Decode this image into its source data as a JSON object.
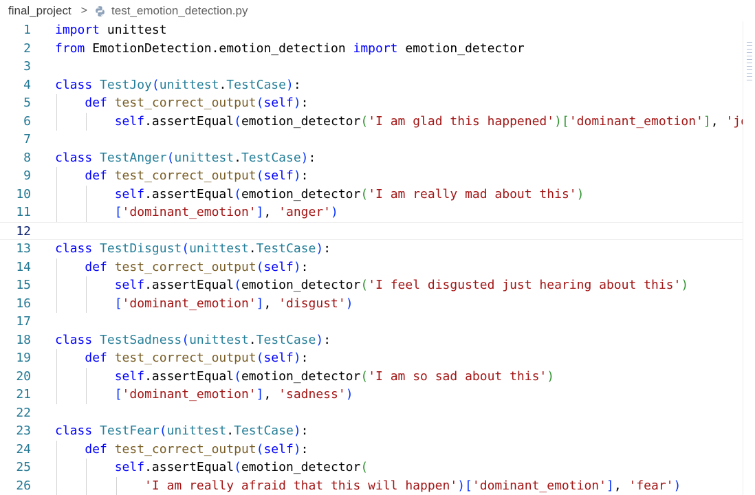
{
  "breadcrumb": {
    "folder": "final_project",
    "separator": ">",
    "file": "test_emotion_detection.py",
    "file_icon": "python-icon"
  },
  "editor": {
    "language": "python",
    "current_line": 12,
    "lines": [
      {
        "number": "1",
        "text": "import unittest"
      },
      {
        "number": "2",
        "text": "from EmotionDetection.emotion_detection import emotion_detector"
      },
      {
        "number": "3",
        "text": ""
      },
      {
        "number": "4",
        "text": "class TestJoy(unittest.TestCase):"
      },
      {
        "number": "5",
        "text": "    def test_correct_output(self):"
      },
      {
        "number": "6",
        "text": "        self.assertEqual(emotion_detector('I am glad this happened')['dominant_emotion'], 'joy"
      },
      {
        "number": "7",
        "text": ""
      },
      {
        "number": "8",
        "text": "class TestAnger(unittest.TestCase):"
      },
      {
        "number": "9",
        "text": "    def test_correct_output(self):"
      },
      {
        "number": "10",
        "text": "        self.assertEqual(emotion_detector('I am really mad about this')"
      },
      {
        "number": "11",
        "text": "        ['dominant_emotion'], 'anger')"
      },
      {
        "number": "12",
        "text": ""
      },
      {
        "number": "13",
        "text": "class TestDisgust(unittest.TestCase):"
      },
      {
        "number": "14",
        "text": "    def test_correct_output(self):"
      },
      {
        "number": "15",
        "text": "        self.assertEqual(emotion_detector('I feel disgusted just hearing about this')"
      },
      {
        "number": "16",
        "text": "        ['dominant_emotion'], 'disgust')"
      },
      {
        "number": "17",
        "text": ""
      },
      {
        "number": "18",
        "text": "class TestSadness(unittest.TestCase):"
      },
      {
        "number": "19",
        "text": "    def test_correct_output(self):"
      },
      {
        "number": "20",
        "text": "        self.assertEqual(emotion_detector('I am so sad about this')"
      },
      {
        "number": "21",
        "text": "        ['dominant_emotion'], 'sadness')"
      },
      {
        "number": "22",
        "text": ""
      },
      {
        "number": "23",
        "text": "class TestFear(unittest.TestCase):"
      },
      {
        "number": "24",
        "text": "    def test_correct_output(self):"
      },
      {
        "number": "25",
        "text": "        self.assertEqual(emotion_detector("
      },
      {
        "number": "26",
        "text": "            'I am really afraid that this will happen')['dominant_emotion'], 'fear')"
      }
    ]
  },
  "colors": {
    "keyword": "#0000ff",
    "class_name": "#267f99",
    "function": "#795e26",
    "string": "#a31515",
    "variable": "#001080",
    "bracket_level_1": "#0431fa",
    "bracket_level_2": "#319331",
    "bracket_level_3": "#7b3814",
    "line_number": "#237893",
    "active_line_number": "#0b216f"
  }
}
